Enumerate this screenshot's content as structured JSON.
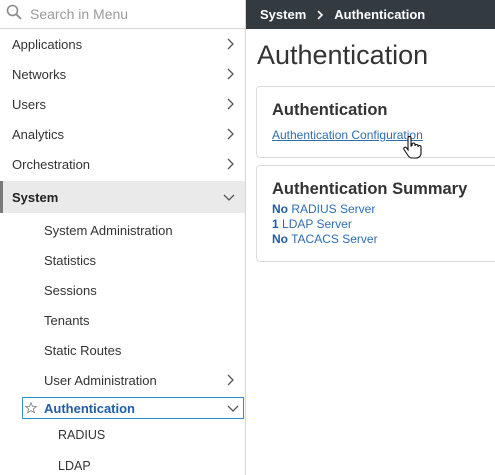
{
  "search": {
    "placeholder": "Search in Menu"
  },
  "sidebar": {
    "items": [
      {
        "label": "Applications"
      },
      {
        "label": "Networks"
      },
      {
        "label": "Users"
      },
      {
        "label": "Analytics"
      },
      {
        "label": "Orchestration"
      }
    ],
    "active": {
      "label": "System"
    },
    "subitems": [
      {
        "label": "System Administration"
      },
      {
        "label": "Statistics"
      },
      {
        "label": "Sessions"
      },
      {
        "label": "Tenants"
      },
      {
        "label": "Static Routes"
      },
      {
        "label": "User Administration"
      }
    ],
    "selected": {
      "label": "Authentication"
    },
    "third": [
      {
        "label": "RADIUS"
      },
      {
        "label": "LDAP"
      }
    ]
  },
  "breadcrumb": {
    "first": "System",
    "second": "Authentication"
  },
  "page": {
    "title": "Authentication"
  },
  "card_auth": {
    "title": "Authentication",
    "link": "Authentication Configuration"
  },
  "card_summary": {
    "title": "Authentication Summary",
    "lines": [
      {
        "count": "No",
        "text": " RADIUS Server"
      },
      {
        "count": "1",
        "text": " LDAP Server"
      },
      {
        "count": "No",
        "text": " TACACS Server"
      }
    ]
  },
  "colors": {
    "accent": "#2c6fb3",
    "topbar": "#333a40",
    "selected_border": "#2c8ccf"
  }
}
